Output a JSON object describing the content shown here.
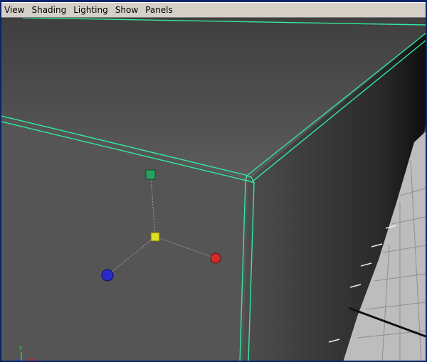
{
  "menubar": {
    "items": [
      {
        "id": "view",
        "label": "View"
      },
      {
        "id": "shading",
        "label": "Shading"
      },
      {
        "id": "lighting",
        "label": "Lighting"
      },
      {
        "id": "show",
        "label": "Show"
      },
      {
        "id": "panels",
        "label": "Panels"
      }
    ]
  },
  "viewport": {
    "axis_indicator": {
      "y_label": "Y"
    }
  },
  "colors": {
    "menubar_bg": "#d4d0c8",
    "window_border": "#0a246a",
    "selection_edge": "#33e8a0",
    "background_gradient_top": "#4a4a4a",
    "background_gradient_bottom": "#2a2a2a",
    "grid_floor": "#b9b9b9",
    "grid_lines": "#8c8c8c",
    "manip_x": "#d42a2a",
    "manip_y": "#2aa060",
    "manip_z": "#2a2acc",
    "manip_center": "#e0e020"
  }
}
